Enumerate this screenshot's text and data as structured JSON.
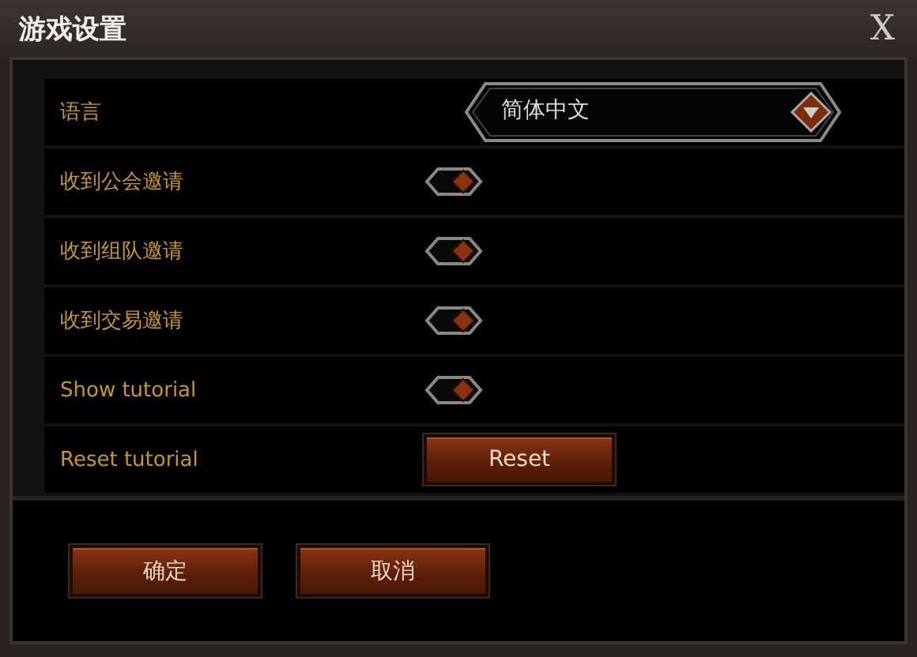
{
  "window": {
    "title": "游戏设置",
    "close_label": "X"
  },
  "settings": [
    {
      "kind": "dropdown",
      "label": "语言",
      "value": "简体中文"
    },
    {
      "kind": "toggle",
      "label": "收到公会邀请",
      "on": true
    },
    {
      "kind": "toggle",
      "label": "收到组队邀请",
      "on": true
    },
    {
      "kind": "toggle",
      "label": "收到交易邀请",
      "on": true
    },
    {
      "kind": "toggle",
      "label": "Show tutorial",
      "on": true
    },
    {
      "kind": "button",
      "label": "Reset tutorial",
      "button": "Reset"
    }
  ],
  "buttons": [
    "确定",
    "取消"
  ]
}
